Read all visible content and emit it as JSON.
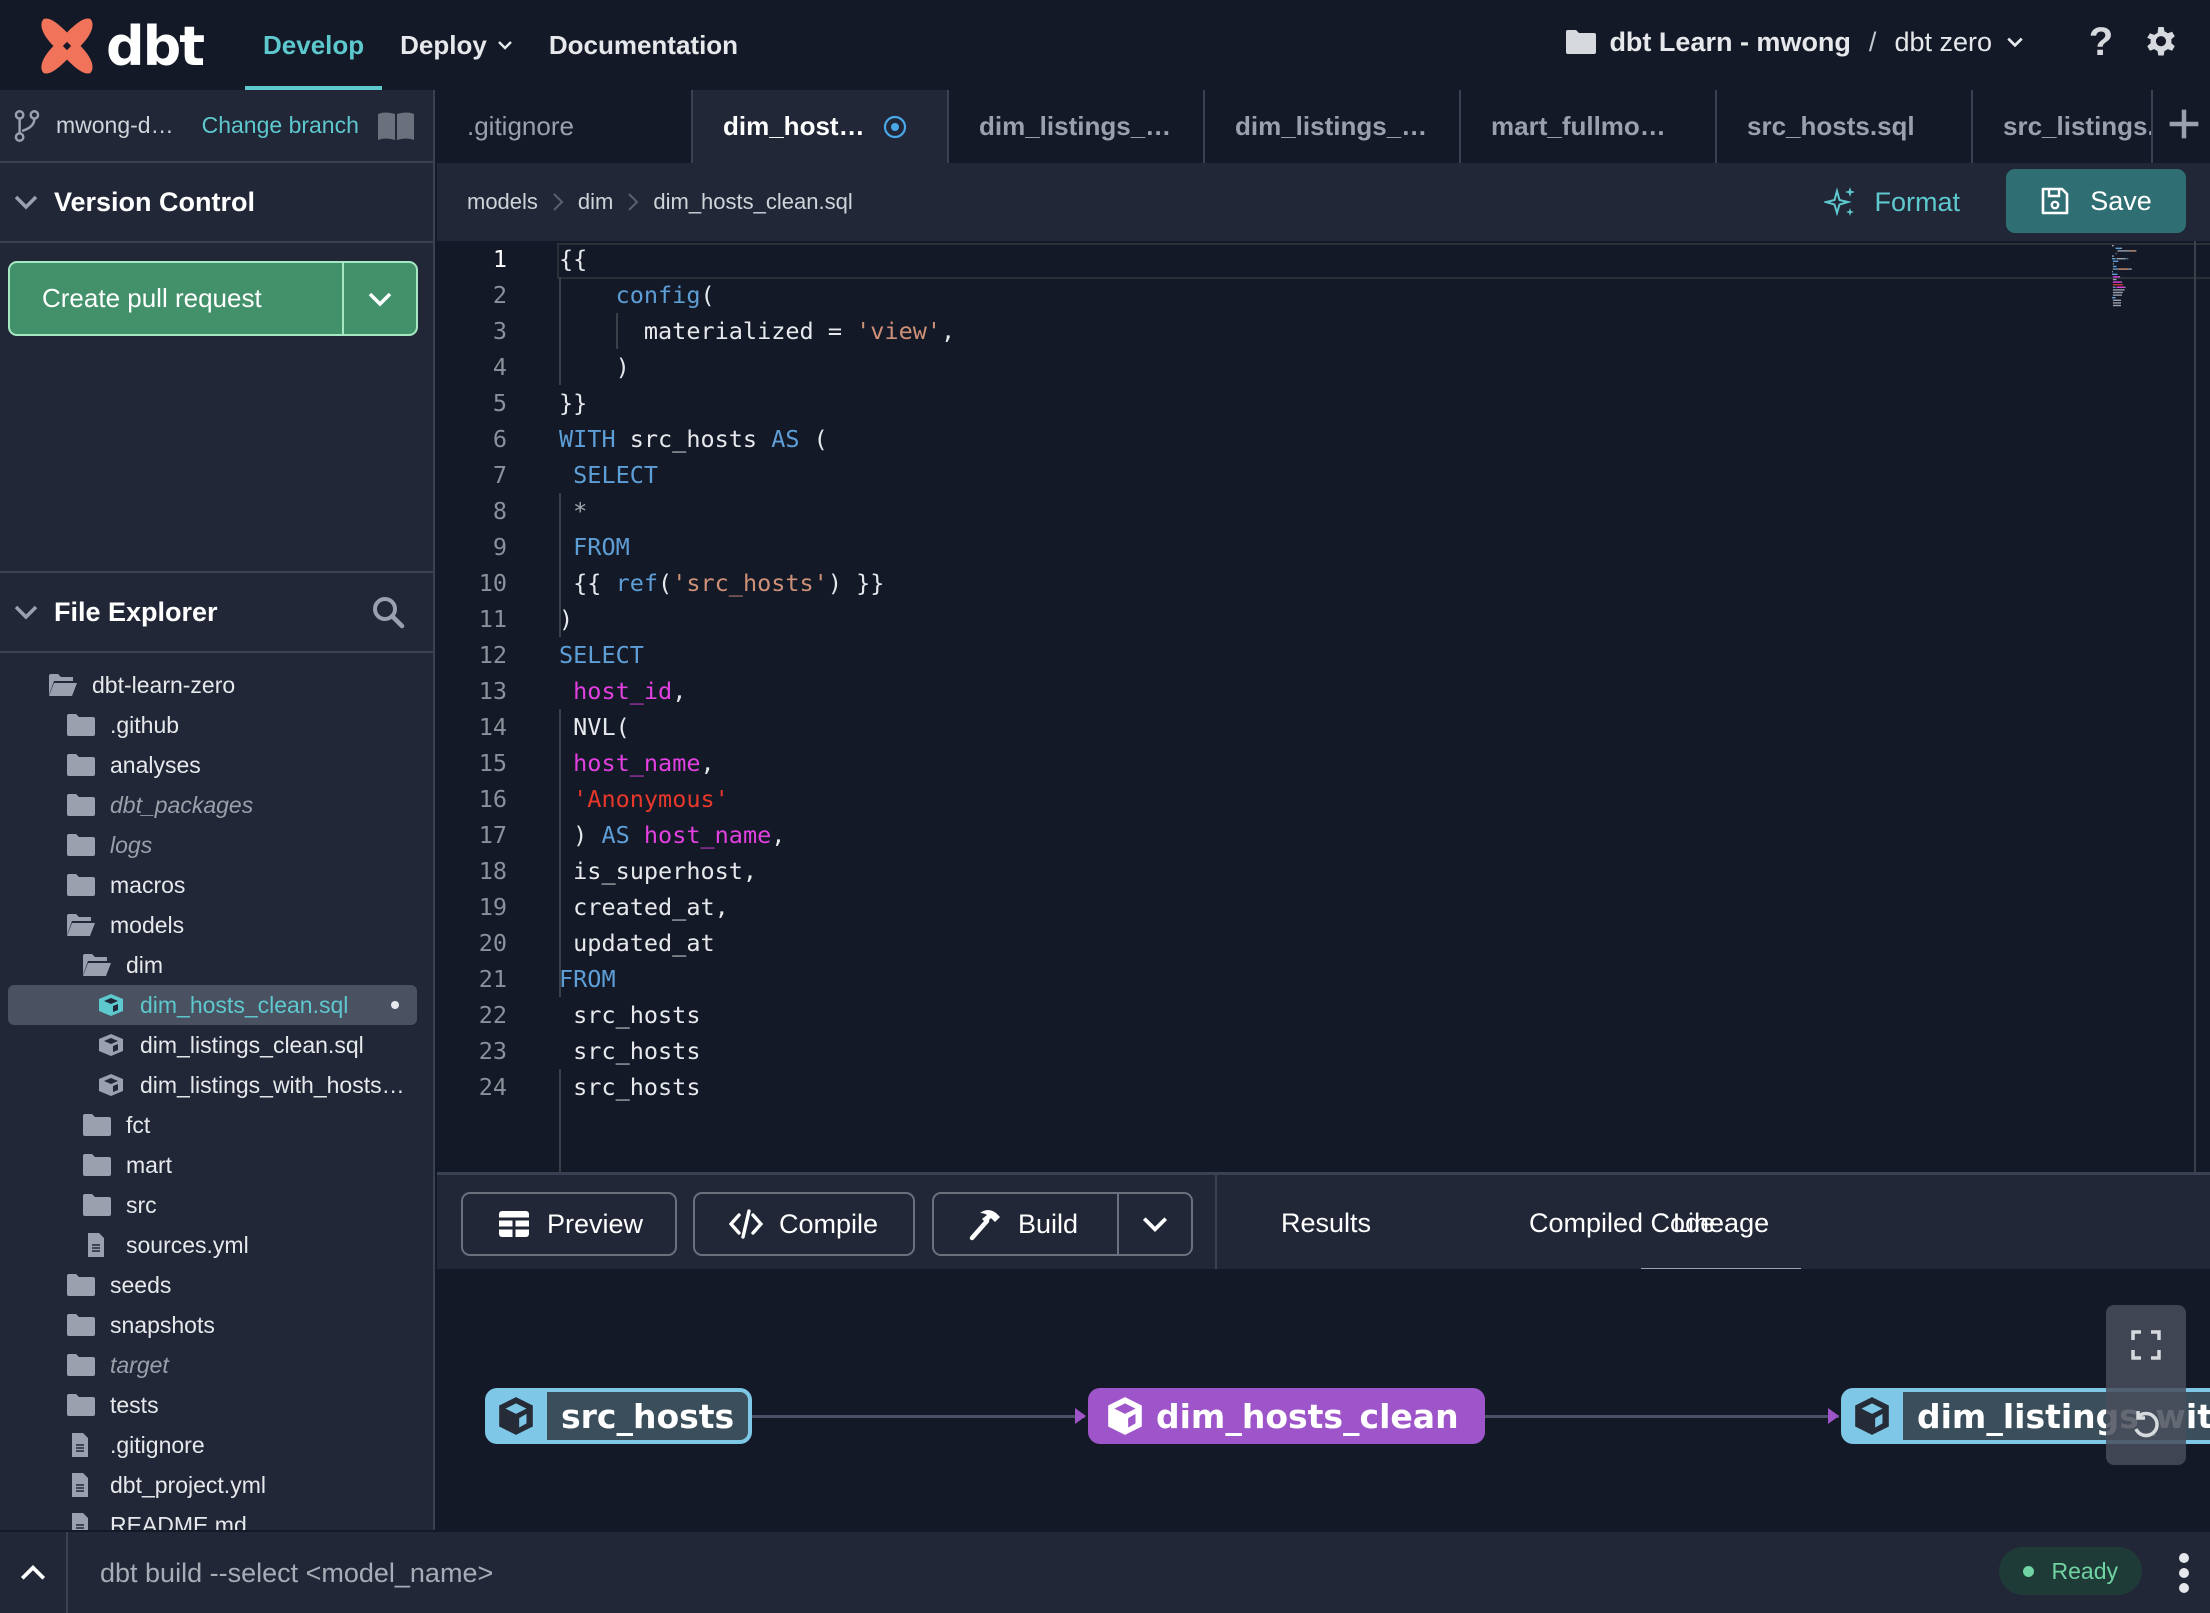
{
  "header": {
    "logo_text": "dbt",
    "nav": [
      {
        "label": "Develop",
        "active": true
      },
      {
        "label": "Deploy",
        "has_dropdown": true
      },
      {
        "label": "Documentation"
      }
    ],
    "account": "dbt Learn - mwong",
    "separator": "/",
    "project": "dbt zero",
    "help_label": "?"
  },
  "sidebar": {
    "branch_name": "mwong-d…",
    "change_branch_label": "Change branch",
    "version_control": {
      "title": "Version Control",
      "create_pr_label": "Create pull request"
    },
    "file_explorer": {
      "title": "File Explorer",
      "items": [
        {
          "name": "dbt-learn-zero",
          "type": "folder-open",
          "depth": 0
        },
        {
          "name": ".github",
          "type": "folder",
          "depth": 1
        },
        {
          "name": "analyses",
          "type": "folder",
          "depth": 1
        },
        {
          "name": "dbt_packages",
          "type": "folder",
          "depth": 1,
          "ignored": true
        },
        {
          "name": "logs",
          "type": "folder",
          "depth": 1,
          "ignored": true
        },
        {
          "name": "macros",
          "type": "folder",
          "depth": 1
        },
        {
          "name": "models",
          "type": "folder-open",
          "depth": 1
        },
        {
          "name": "dim",
          "type": "folder-open",
          "depth": 2
        },
        {
          "name": "dim_hosts_clean.sql",
          "type": "model",
          "depth": 3,
          "selected": true,
          "modified": true
        },
        {
          "name": "dim_listings_clean.sql",
          "type": "model",
          "depth": 3
        },
        {
          "name": "dim_listings_with_hosts…",
          "type": "model",
          "depth": 3
        },
        {
          "name": "fct",
          "type": "folder",
          "depth": 2
        },
        {
          "name": "mart",
          "type": "folder",
          "depth": 2
        },
        {
          "name": "src",
          "type": "folder",
          "depth": 2
        },
        {
          "name": "sources.yml",
          "type": "file",
          "depth": 2
        },
        {
          "name": "seeds",
          "type": "folder",
          "depth": 1
        },
        {
          "name": "snapshots",
          "type": "folder",
          "depth": 1
        },
        {
          "name": "target",
          "type": "folder",
          "depth": 1,
          "ignored": true
        },
        {
          "name": "tests",
          "type": "folder",
          "depth": 1
        },
        {
          "name": ".gitignore",
          "type": "file",
          "depth": 1
        },
        {
          "name": "dbt_project.yml",
          "type": "file",
          "depth": 1
        },
        {
          "name": "README.md",
          "type": "file",
          "depth": 1
        }
      ]
    }
  },
  "tabs": [
    {
      "label": ".gitignore"
    },
    {
      "label": "dim_host…",
      "active": true,
      "modified": true
    },
    {
      "label": "dim_listings_…"
    },
    {
      "label": "dim_listings_…"
    },
    {
      "label": "mart_fullmo…"
    },
    {
      "label": "src_hosts.sql"
    },
    {
      "label": "src_listings."
    }
  ],
  "breadcrumb": [
    "models",
    "dim",
    "dim_hosts_clean.sql"
  ],
  "toolbar": {
    "format_label": "Format",
    "save_label": "Save"
  },
  "editor": {
    "current_line": 1,
    "lines": [
      [
        {
          "t": "{{",
          "c": ""
        }
      ],
      [
        {
          "t": "    ",
          "c": ""
        },
        {
          "t": "config",
          "c": "fn"
        },
        {
          "t": "(",
          "c": ""
        }
      ],
      [
        {
          "t": "      materialized = ",
          "c": ""
        },
        {
          "t": "'view'",
          "c": "str"
        },
        {
          "t": ",",
          "c": ""
        }
      ],
      [
        {
          "t": "    )",
          "c": ""
        }
      ],
      [
        {
          "t": "}}",
          "c": ""
        }
      ],
      [
        {
          "t": "WITH",
          "c": "kw"
        },
        {
          "t": " src_hosts ",
          "c": ""
        },
        {
          "t": "AS",
          "c": "kw"
        },
        {
          "t": " (",
          "c": ""
        }
      ],
      [
        {
          "t": " ",
          "c": ""
        },
        {
          "t": "SELECT",
          "c": "kw"
        }
      ],
      [
        {
          "t": " ",
          "c": ""
        },
        {
          "t": "*",
          "c": "op"
        }
      ],
      [
        {
          "t": " ",
          "c": ""
        },
        {
          "t": "FROM",
          "c": "kw"
        }
      ],
      [
        {
          "t": " {{ ",
          "c": ""
        },
        {
          "t": "ref",
          "c": "fn"
        },
        {
          "t": "(",
          "c": ""
        },
        {
          "t": "'src_hosts'",
          "c": "str"
        },
        {
          "t": ") }}",
          "c": ""
        }
      ],
      [
        {
          "t": ")",
          "c": ""
        }
      ],
      [
        {
          "t": "SELECT",
          "c": "kw"
        }
      ],
      [
        {
          "t": " ",
          "c": ""
        },
        {
          "t": "host_id",
          "c": "col"
        },
        {
          "t": ",",
          "c": ""
        }
      ],
      [
        {
          "t": " NVL(",
          "c": ""
        }
      ],
      [
        {
          "t": " ",
          "c": ""
        },
        {
          "t": "host_name",
          "c": "col"
        },
        {
          "t": ",",
          "c": ""
        }
      ],
      [
        {
          "t": " ",
          "c": ""
        },
        {
          "t": "'Anonymous'",
          "c": "str2"
        }
      ],
      [
        {
          "t": " ) ",
          "c": ""
        },
        {
          "t": "AS",
          "c": "kw"
        },
        {
          "t": " ",
          "c": ""
        },
        {
          "t": "host_name",
          "c": "col"
        },
        {
          "t": ",",
          "c": ""
        }
      ],
      [
        {
          "t": " is_superhost,",
          "c": ""
        }
      ],
      [
        {
          "t": " created_at,",
          "c": ""
        }
      ],
      [
        {
          "t": " updated_at",
          "c": ""
        }
      ],
      [
        {
          "t": "FROM",
          "c": "kw"
        }
      ],
      [
        {
          "t": " src_hosts",
          "c": ""
        }
      ],
      [
        {
          "t": " src_hosts",
          "c": ""
        }
      ],
      [
        {
          "t": " src_hosts",
          "c": ""
        }
      ]
    ]
  },
  "bottom_panel": {
    "buttons": {
      "preview": "Preview",
      "compile": "Compile",
      "build": "Build"
    },
    "tabs": [
      {
        "label": "Results"
      },
      {
        "label": "Compiled Code"
      },
      {
        "label": "Lineage",
        "active": true
      }
    ],
    "lineage": {
      "nodes": [
        {
          "label": "src_hosts",
          "kind": "source"
        },
        {
          "label": "dim_hosts_clean",
          "kind": "model",
          "current": true
        },
        {
          "label": "dim_listings_with_hosts",
          "kind": "source"
        }
      ]
    }
  },
  "statusbar": {
    "command_placeholder": "dbt build --select <model_name>",
    "status": "Ready"
  },
  "colors": {
    "accent": "#5ec8cf",
    "background": "#131926",
    "panel": "#212736",
    "create_pr": "#42916a",
    "save": "#2f6f73",
    "lineage_model": "#9e55c9",
    "lineage_source": "#7ec7e6",
    "ready": "#6fd3a2",
    "logo": "#f0735a"
  }
}
